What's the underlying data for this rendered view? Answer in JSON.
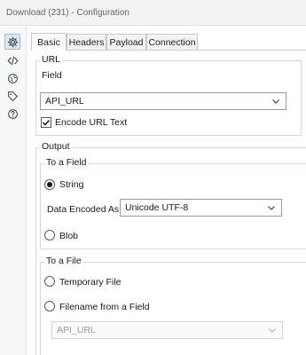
{
  "window": {
    "title": "Download (231) - Configuration"
  },
  "sidebar": {
    "icons": [
      "gear-icon",
      "code-icon",
      "globe-icon",
      "tag-icon",
      "help-icon"
    ]
  },
  "tabs": [
    {
      "label": "Basic",
      "active": true
    },
    {
      "label": "Headers",
      "active": false
    },
    {
      "label": "Payload",
      "active": false
    },
    {
      "label": "Connection",
      "active": false
    }
  ],
  "url": {
    "group_label": "URL",
    "field_label": "Field",
    "field_value": "API_URL",
    "encode_label": "Encode URL Text",
    "encode_checked": true
  },
  "output": {
    "group_label": "Output",
    "to_field": {
      "group_label": "To a Field",
      "string_label": "String",
      "string_selected": true,
      "encoded_label": "Data Encoded As",
      "encoded_value": "Unicode UTF-8",
      "blob_label": "Blob",
      "blob_selected": false
    },
    "to_file": {
      "group_label": "To a File",
      "temp_label": "Temporary File",
      "temp_selected": false,
      "filename_label": "Filename from a Field",
      "filename_selected": false,
      "filename_value": "API_URL"
    }
  }
}
